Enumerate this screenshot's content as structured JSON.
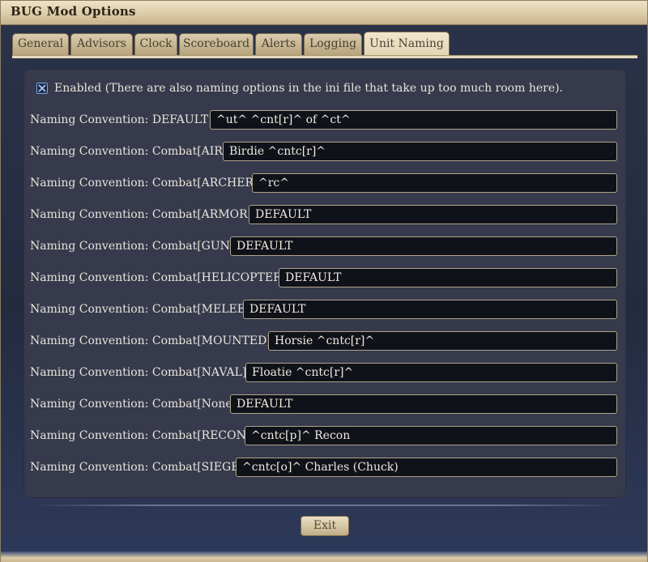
{
  "window": {
    "title": "BUG Mod Options"
  },
  "tabs": [
    {
      "label": "General"
    },
    {
      "label": "Advisors"
    },
    {
      "label": "Clock"
    },
    {
      "label": "Scoreboard"
    },
    {
      "label": "Alerts"
    },
    {
      "label": "Logging"
    },
    {
      "label": "Unit Naming",
      "active": true
    }
  ],
  "enabled": {
    "checked": true,
    "label": "Enabled (There are also naming options in the ini file that take up too much room here)."
  },
  "rows": [
    {
      "label": "Naming Convention: DEFAULT",
      "value": "^ut^ ^cnt[r]^ of ^ct^"
    },
    {
      "label": "Naming Convention: Combat[AIR]",
      "value": "Birdie ^cntc[r]^"
    },
    {
      "label": "Naming Convention: Combat[ARCHER]",
      "value": "^rc^"
    },
    {
      "label": "Naming Convention: Combat[ARMOR]",
      "value": "DEFAULT"
    },
    {
      "label": "Naming Convention: Combat[GUN]",
      "value": "DEFAULT"
    },
    {
      "label": "Naming Convention: Combat[HELICOPTER]",
      "value": "DEFAULT"
    },
    {
      "label": "Naming Convention: Combat[MELEE]",
      "value": "DEFAULT"
    },
    {
      "label": "Naming Convention: Combat[MOUNTED]",
      "value": "Horsie ^cntc[r]^"
    },
    {
      "label": "Naming Convention: Combat[NAVAL]",
      "value": "Floatie ^cntc[r]^"
    },
    {
      "label": "Naming Convention: Combat[None]",
      "value": "DEFAULT"
    },
    {
      "label": "Naming Convention: Combat[RECON]",
      "value": "^cntc[p]^ Recon"
    },
    {
      "label": "Naming Convention: Combat[SIEGE]",
      "value": "^cntc[o]^ Charles (Chuck)"
    }
  ],
  "buttons": {
    "exit": "Exit"
  },
  "colors": {
    "panel": "#363a4c",
    "field": "#10121a",
    "accent": "#dccca8",
    "text": "#e9e4da"
  },
  "icons": {
    "checkbox": "checkbox-checked-icon"
  }
}
